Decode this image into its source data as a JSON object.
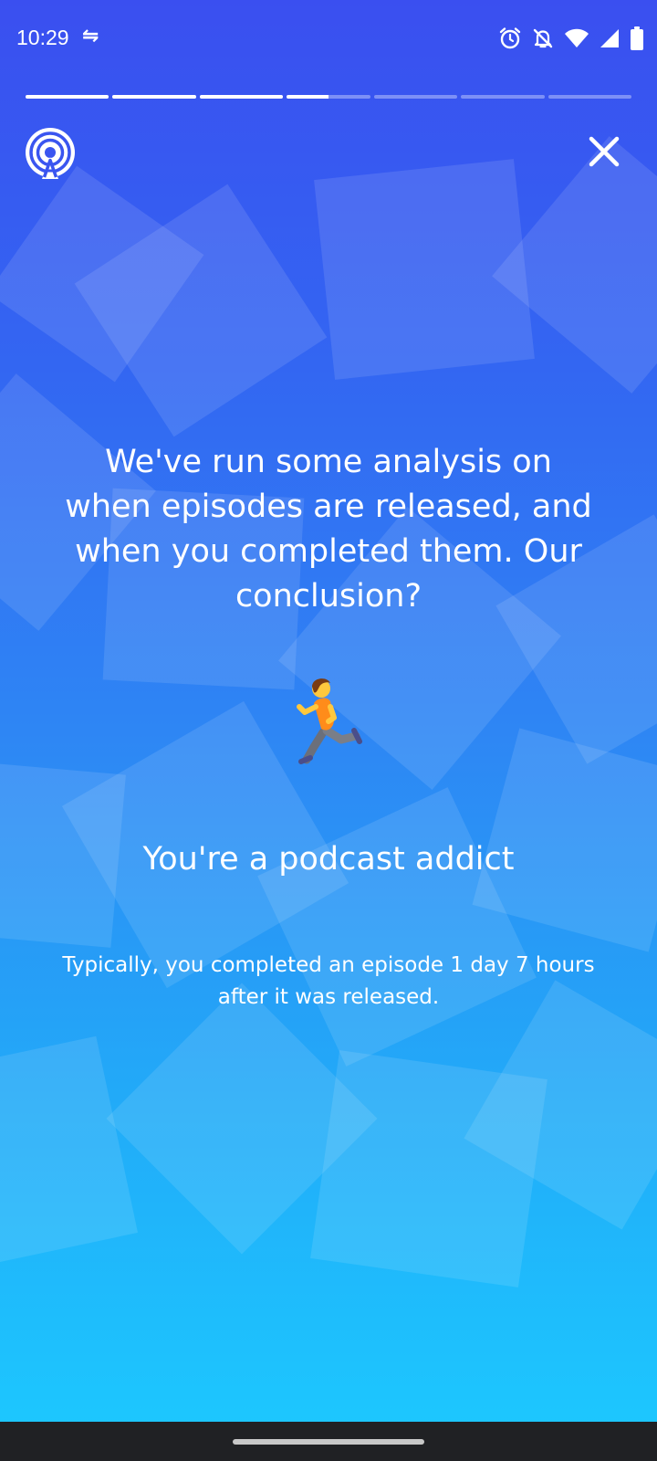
{
  "status_bar": {
    "time": "10:29",
    "sync_glyph": "⇋",
    "icons": [
      "alarm-icon",
      "notifications-off-icon",
      "wifi-icon",
      "signal-icon",
      "battery-icon"
    ]
  },
  "story": {
    "segment_count": 7,
    "progress": [
      1,
      1,
      1,
      0.5,
      0,
      0,
      0
    ]
  },
  "header": {
    "logo": "podcast-app-logo",
    "close_icon": "close-icon"
  },
  "content": {
    "headline": "We've run some analysis on when episodes are released, and when you completed them. Our conclusion?",
    "emoji_icon": "person-running-emoji",
    "verdict": "You're a podcast addict",
    "detail": "Typically, you completed an episode 1 day 7 hours after it was released."
  },
  "colors": {
    "gradient_top": "#3a4ff0",
    "gradient_bottom": "#1ccaff",
    "text": "#ffffff",
    "nav_bar": "#202124"
  }
}
